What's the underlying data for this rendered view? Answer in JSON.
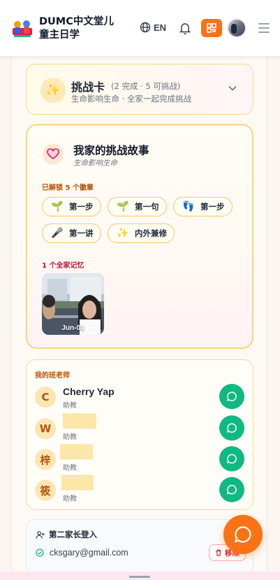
{
  "header": {
    "app_title": "DUMC中文堂儿童主日学",
    "language": "EN",
    "icons": [
      "logo-icon",
      "globe-icon",
      "bell-icon",
      "qr-code-icon",
      "hamburger-menu-icon"
    ],
    "accent_color": "#f97316"
  },
  "challenge": {
    "title": "挑战卡",
    "stats": "(2 完成 · 5 可挑战)",
    "subtitle": "生命影响生命 · 全家一起完成挑战",
    "icon": "sparkles-icon"
  },
  "story": {
    "title": "我家的挑战故事",
    "subtitle": "生命影响生命",
    "badges_heading": "已解锁 5 个徽章",
    "badges": [
      {
        "icon": "sprout-icon",
        "label": "第一步"
      },
      {
        "icon": "sprout-icon",
        "label": "第一句"
      },
      {
        "icon": "footprints-icon",
        "label": "第一步"
      },
      {
        "icon": "microphone-icon",
        "label": "第一讲"
      },
      {
        "icon": "sparkles-icon",
        "label": "内外兼修"
      }
    ],
    "memories_heading": "1 个全家记忆",
    "memories": [
      {
        "date": "Jun-03"
      }
    ]
  },
  "teachers": {
    "heading": "我的班老师",
    "list": [
      {
        "initial": "C",
        "name": "Cherry Yap",
        "role": "助教",
        "redacted": false
      },
      {
        "initial": "W",
        "name": "",
        "role": "助教",
        "redacted": true
      },
      {
        "initial": "梓",
        "name": "",
        "role": "助教",
        "redacted": true
      },
      {
        "initial": "筱",
        "name": "",
        "role": "助教",
        "redacted": true
      }
    ],
    "chat_color": "#10b981"
  },
  "second_parent": {
    "title": "第二家长登入",
    "email": "cksgary@gmail.com",
    "remove_label": "移除"
  }
}
